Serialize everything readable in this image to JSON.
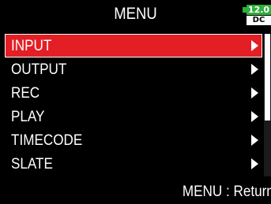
{
  "header": {
    "title": "MENU",
    "battery": {
      "voltage": "12.0",
      "source": "DC",
      "color": "#2fae3c"
    }
  },
  "menu": {
    "items": [
      {
        "label": "INPUT",
        "selected": true
      },
      {
        "label": "OUTPUT",
        "selected": false
      },
      {
        "label": "REC",
        "selected": false
      },
      {
        "label": "PLAY",
        "selected": false
      },
      {
        "label": "TIMECODE",
        "selected": false
      },
      {
        "label": "SLATE",
        "selected": false
      }
    ],
    "selected_color": "#e31e24",
    "arrow_icon": "triangle-right-icon"
  },
  "scrollbar": {
    "position_fraction": 0.0
  },
  "footer": {
    "hint": "MENU : Return"
  }
}
